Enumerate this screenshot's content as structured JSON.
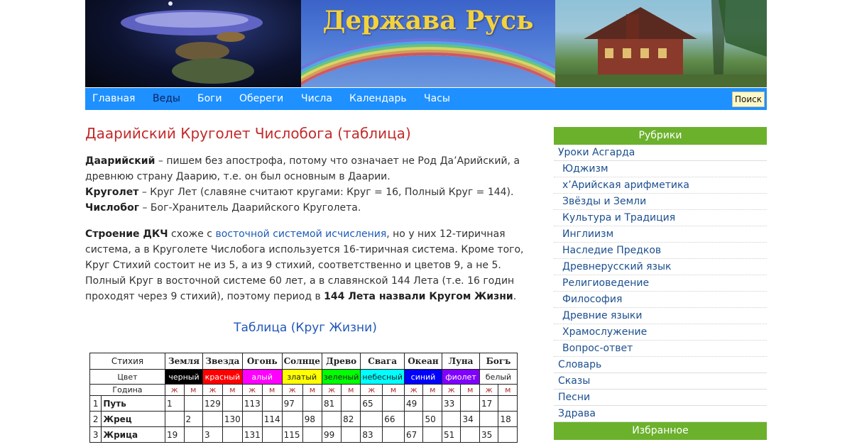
{
  "site": {
    "title": "Держава Русь"
  },
  "nav": {
    "items": [
      {
        "label": "Главная",
        "active": false
      },
      {
        "label": "Веды",
        "active": true
      },
      {
        "label": "Боги",
        "active": false
      },
      {
        "label": "Обереги",
        "active": false
      },
      {
        "label": "Числа",
        "active": false
      },
      {
        "label": "Календарь",
        "active": false
      },
      {
        "label": "Часы",
        "active": false
      }
    ],
    "search_label": "Поиск"
  },
  "article": {
    "title": "Даарийский Круголет Числобога (таблица)",
    "p1": {
      "t1_bold": "Даарийский",
      "t1": " – пишем без апострофа, потому что означает не Род Да’Арийский, а древнюю страну Даарию, т.е. он был основным в Даарии.",
      "t2_bold": "Круголет",
      "t2": " – Круг Лет (славяне считают кругами: Круг = 16, Полный Круг = 144).",
      "t3_bold": "Числобог",
      "t3": " – Бог-Хранитель Даарийского Круголета."
    },
    "p2": {
      "bold1": "Строение ДКЧ",
      "text1": " схоже с ",
      "link": "восточной системой исчисления",
      "text2": ", но у них 12-тиричная система, а в Круголете Числобога используется 16-тиричная система. Кроме того, Круг Стихий состоит не из 5, а из 9 стихий, соответственно и цветов 9, а не 5. Полный Круг в восточной системе 60 лет, а в славянской 144 Лета (т.е. 16 годин проходят через 9 стихий), поэтому период в ",
      "bold2": "144 Лета назвали Кругом Жизни",
      "text3": "."
    },
    "table_caption": "Таблица (Круг Жизни)"
  },
  "table": {
    "header_label": "Стихия",
    "color_label": "Цвет",
    "godina_label": "Година",
    "elements": [
      "Земля",
      "Звезда",
      "Огонь",
      "Солнце",
      "Древо",
      "Свага",
      "Океан",
      "Луна",
      "Богъ"
    ],
    "colors": [
      {
        "name": "черный",
        "bg": "#000000",
        "fg": "#ffffff"
      },
      {
        "name": "красный",
        "bg": "#ff0000",
        "fg": "#ffffff"
      },
      {
        "name": "алый",
        "bg": "#ff00ff",
        "fg": "#ffffff"
      },
      {
        "name": "златый",
        "bg": "#ffff00",
        "fg": "#222222"
      },
      {
        "name": "зеленый",
        "bg": "#00ff00",
        "fg": "#222222"
      },
      {
        "name": "небесный",
        "bg": "#00ffff",
        "fg": "#222222"
      },
      {
        "name": "синий",
        "bg": "#0000ff",
        "fg": "#ffffff"
      },
      {
        "name": "фиолет",
        "bg": "#8000ff",
        "fg": "#ffffff"
      },
      {
        "name": "белый",
        "bg": "#ffffff",
        "fg": "#222222"
      }
    ],
    "zh": "ж",
    "m": "м",
    "rows": [
      {
        "n": "1",
        "name": "Путь",
        "cells": [
          "1",
          "",
          "129",
          "",
          "113",
          "",
          "97",
          "",
          "81",
          "",
          "65",
          "",
          "49",
          "",
          "33",
          "",
          "17",
          ""
        ]
      },
      {
        "n": "2",
        "name": "Жрец",
        "cells": [
          "",
          "2",
          "",
          "130",
          "",
          "114",
          "",
          "98",
          "",
          "82",
          "",
          "66",
          "",
          "50",
          "",
          "34",
          "",
          "18"
        ]
      },
      {
        "n": "3",
        "name": "Жрица",
        "cells": [
          "19",
          "",
          "3",
          "",
          "131",
          "",
          "115",
          "",
          "99",
          "",
          "83",
          "",
          "67",
          "",
          "51",
          "",
          "35",
          ""
        ]
      }
    ]
  },
  "sidebar": {
    "rubrics_title": "Рубрики",
    "items": [
      {
        "label": "Уроки Асгарда",
        "sub": false
      },
      {
        "label": "Юджизм",
        "sub": true
      },
      {
        "label": "х’Арийская арифметика",
        "sub": true
      },
      {
        "label": "Звёзды и Земли",
        "sub": true
      },
      {
        "label": "Культура и Традиция",
        "sub": true
      },
      {
        "label": "Инглиизм",
        "sub": true
      },
      {
        "label": "Наследие Предков",
        "sub": true
      },
      {
        "label": "Древнерусский язык",
        "sub": true
      },
      {
        "label": "Религиоведение",
        "sub": true
      },
      {
        "label": "Философия",
        "sub": true
      },
      {
        "label": "Древние языки",
        "sub": true
      },
      {
        "label": "Храмослужение",
        "sub": true
      },
      {
        "label": "Вопрос-ответ",
        "sub": true
      },
      {
        "label": "Словарь",
        "sub": false
      },
      {
        "label": "Сказы",
        "sub": false
      },
      {
        "label": "Песни",
        "sub": false
      },
      {
        "label": "Здрава",
        "sub": false
      }
    ],
    "favorites_title": "Избранное"
  }
}
